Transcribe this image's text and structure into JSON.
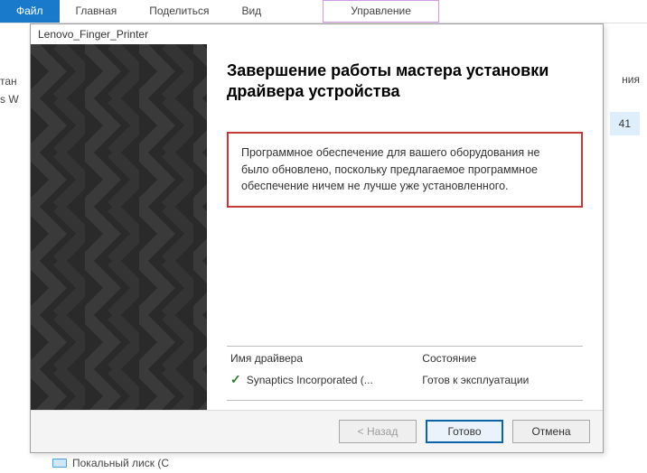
{
  "ribbon": {
    "tabs": {
      "file": "Файл",
      "home": "Главная",
      "share": "Поделиться",
      "view": "Вид",
      "manage": "Управление"
    }
  },
  "bg": {
    "left_line1": "тан",
    "left_line2": "s W",
    "right_line": "ния",
    "right_row2": "41",
    "bottom_item": "Покальный лиск (С"
  },
  "dialog": {
    "title": "Lenovo_Finger_Printer",
    "heading": "Завершение работы мастера установки драйвера устройства",
    "message": "Программное обеспечение для вашего оборудования не было обновлено, поскольку предлагаемое программное обеспечение ничем не лучше уже установленного.",
    "table": {
      "col_name": "Имя драйвера",
      "col_status": "Состояние",
      "row": {
        "name": "Synaptics Incorporated (...",
        "status": "Готов к эксплуатации"
      }
    },
    "buttons": {
      "back": "< Назад",
      "finish": "Готово",
      "cancel": "Отмена"
    }
  }
}
